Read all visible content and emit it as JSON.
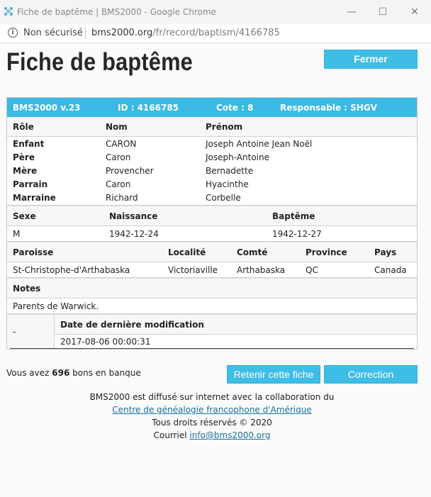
{
  "window": {
    "title": "Fiche de baptême | BMS2000 - Google Chrome",
    "minimize": "—",
    "maximize": "☐",
    "close": "✕"
  },
  "address_bar": {
    "security_label": "Non sécurisé",
    "host": "bms2000.org",
    "path": "/fr/record/baptism/4166785"
  },
  "page": {
    "title": "Fiche de baptême",
    "close_button": "Fermer"
  },
  "record": {
    "header": {
      "version": "BMS2000 v.23",
      "id": "ID : 4166785",
      "cote": "Cote : 8",
      "responsable": "Responsable : SHGV"
    },
    "people_headers": {
      "role": "Rôle",
      "nom": "Nom",
      "prenom": "Prénom"
    },
    "people": [
      {
        "role": "Enfant",
        "nom": "CARON",
        "prenom": "Joseph Antoine Jean Noël"
      },
      {
        "role": "Père",
        "nom": "Caron",
        "prenom": "Joseph-Antoine"
      },
      {
        "role": "Mère",
        "nom": "Provencher",
        "prenom": "Bernadette"
      },
      {
        "role": "Parrain",
        "nom": "Caron",
        "prenom": "Hyacinthe"
      },
      {
        "role": "Marraine",
        "nom": "Richard",
        "prenom": "Corbelle"
      }
    ],
    "birth_headers": {
      "sexe": "Sexe",
      "naissance": "Naissance",
      "bapteme": "Baptême"
    },
    "birth": {
      "sexe": "M",
      "naissance": "1942-12-24",
      "bapteme": "1942-12-27"
    },
    "place_headers": {
      "paroisse": "Paroisse",
      "localite": "Localité",
      "comte": "Comté",
      "province": "Province",
      "pays": "Pays"
    },
    "place": {
      "paroisse": "St-Christophe-d'Arthabaska",
      "localite": "Victoriaville",
      "comte": "Arthabaska",
      "province": "QC",
      "pays": "Canada"
    },
    "notes_header": "Notes",
    "notes": "Parents de Warwick.",
    "mod": {
      "left": "-",
      "header": "Date de dernière modification",
      "value": "2017-08-06 00:00:31"
    }
  },
  "bank": {
    "prefix": "Vous avez",
    "count": "696",
    "suffix": "bons en banque"
  },
  "buttons": {
    "keep": "Retenir cette fiche",
    "correction": "Correction"
  },
  "footer": {
    "line1": "BMS2000 est diffusé sur internet avec la collaboration du",
    "link": "Centre de généalogie francophone d'Amérique",
    "rights": "Tous droits réservés © 2020",
    "email_label": "Courriel",
    "email": "info@bms2000.org"
  },
  "colors": {
    "accent": "#3ebde6",
    "header_bar": "#39b9e4",
    "link": "#1b6f9b"
  }
}
